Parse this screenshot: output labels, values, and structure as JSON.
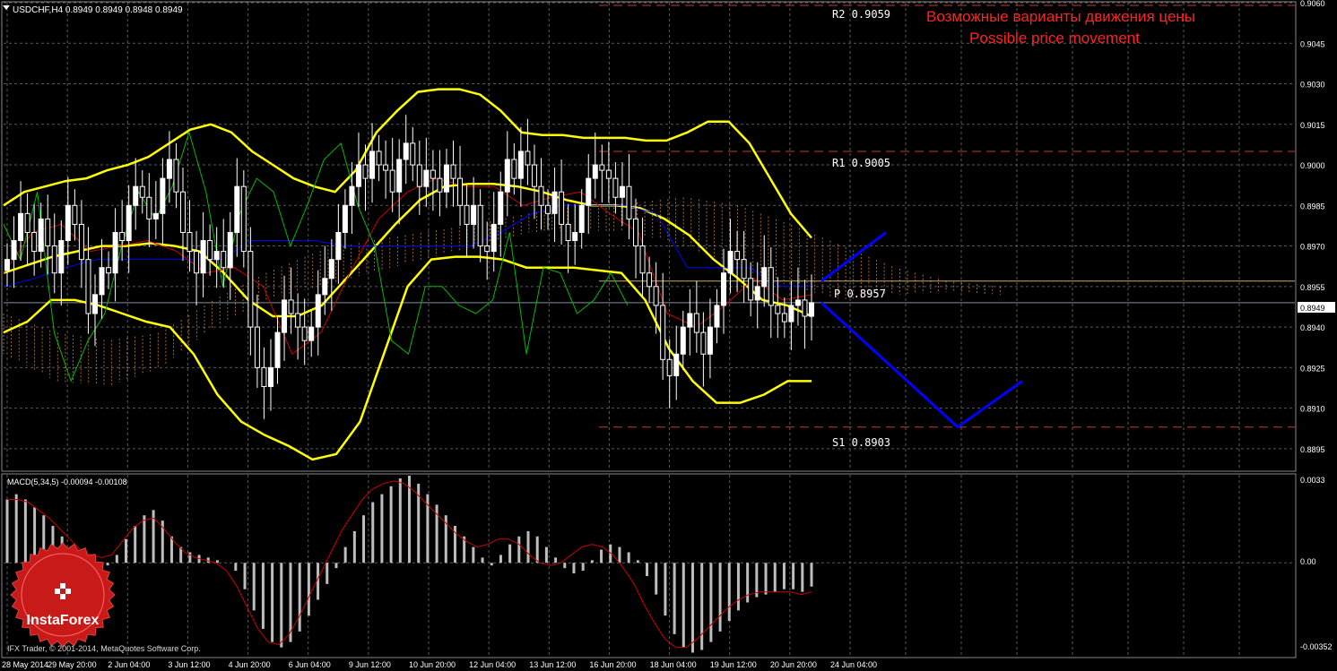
{
  "header": {
    "symbol_info": "USDCHF,H4  0.8949 0.8949 0.8948 0.8949"
  },
  "annotation": {
    "line1": "Возможные варианты движения цены",
    "line2": "Possible price movement"
  },
  "levels": [
    {
      "label": "R2  0.9059",
      "value": 0.9059
    },
    {
      "label": "R1  0.9005",
      "value": 0.9005
    },
    {
      "label": "P  0.8957",
      "value": 0.8957
    },
    {
      "label": "S1  0.8903",
      "value": 0.8903
    }
  ],
  "current_price": {
    "label": "0.8949",
    "value": 0.8949
  },
  "macd_panel": {
    "title": "MACD(5,34,5) -0.00094 -0.00108",
    "axis_labels": [
      "0.0033",
      "0.00",
      "-0.00352"
    ]
  },
  "watermark": {
    "copyright": "IFX Trader, © 2001-2014, MetaQuotes Software Corp.",
    "brand": "InstaForex"
  },
  "colors": {
    "background": "#000000",
    "grid": "#5a5a5a",
    "candles": "#ffffff",
    "bollinger": "#ffff00",
    "kijun": "#0000ff",
    "tenkan": "#cc0000",
    "chikou": "#00bb00",
    "cloud": "#cc8844",
    "forecast": "#0000ff",
    "level_line": "#b84030",
    "pivot_line": "#ccaa66",
    "annotation": "#ff2222"
  },
  "chart_data": [
    {
      "type": "candlestick",
      "title": "USDCHF,H4",
      "ylim": [
        0.8887,
        0.906
      ],
      "y_ticks": [
        "0.9060",
        "0.9045",
        "0.9030",
        "0.9015",
        "0.9000",
        "0.8985",
        "0.8970",
        "0.8955",
        "0.8940",
        "0.8925",
        "0.8910",
        "0.8895"
      ],
      "x_ticks": [
        "28 May 2014",
        "29 May 20:00",
        "2 Jun 04:00",
        "3 Jun 12:00",
        "4 Jun 20:00",
        "6 Jun 04:00",
        "9 Jun 12:00",
        "10 Jun 20:00",
        "12 Jun 04:00",
        "13 Jun 12:00",
        "16 Jun 20:00",
        "18 Jun 04:00",
        "19 Jun 12:00",
        "20 Jun 20:00",
        "24 Jun 04:00"
      ],
      "close": [
        0.8965,
        0.8972,
        0.8982,
        0.8975,
        0.8968,
        0.898,
        0.897,
        0.896,
        0.8972,
        0.8985,
        0.8978,
        0.8965,
        0.8945,
        0.8952,
        0.8962,
        0.896,
        0.8975,
        0.8972,
        0.8985,
        0.8992,
        0.8988,
        0.898,
        0.8982,
        0.8995,
        0.9002,
        0.899,
        0.8975,
        0.8968,
        0.896,
        0.8972,
        0.8965,
        0.8968,
        0.8962,
        0.8975,
        0.8992,
        0.8968,
        0.894,
        0.8925,
        0.8918,
        0.8925,
        0.8938,
        0.895,
        0.8945,
        0.894,
        0.8935,
        0.894,
        0.8952,
        0.8958,
        0.8965,
        0.8975,
        0.8985,
        0.8992,
        0.9,
        0.8995,
        0.9005,
        0.9,
        0.8998,
        0.899,
        0.9002,
        0.9008,
        0.9,
        0.8992,
        0.8998,
        0.8995,
        0.899,
        0.9,
        0.8995,
        0.8985,
        0.8978,
        0.8985,
        0.897,
        0.8968,
        0.8978,
        0.899,
        0.9002,
        0.8995,
        0.9005,
        0.9,
        0.8992,
        0.8985,
        0.8982,
        0.899,
        0.8978,
        0.8972,
        0.8975,
        0.8985,
        0.8995,
        0.9,
        0.8998,
        0.8995,
        0.8988,
        0.8992,
        0.898,
        0.897,
        0.896,
        0.8955,
        0.8948,
        0.8928,
        0.8922,
        0.893,
        0.894,
        0.8945,
        0.8938,
        0.893,
        0.894,
        0.8948,
        0.896,
        0.8968,
        0.8965,
        0.8958,
        0.895,
        0.8955,
        0.8962,
        0.8948,
        0.8945,
        0.8942,
        0.8948,
        0.895,
        0.8944,
        0.8949
      ],
      "series": [
        {
          "name": "Bollinger upper",
          "values": [
            0.8985,
            0.899,
            0.8992,
            0.8994,
            0.8995,
            0.8998,
            0.9,
            0.9003,
            0.9008,
            0.9013,
            0.9015,
            0.9012,
            0.9005,
            0.9,
            0.8995,
            0.8992,
            0.899,
            0.8998,
            0.9012,
            0.902,
            0.9027,
            0.9028,
            0.9028,
            0.9026,
            0.902,
            0.9012,
            0.9011,
            0.9011,
            0.901,
            0.901,
            0.901,
            0.9009,
            0.9009,
            0.9012,
            0.9016,
            0.9016,
            0.9008,
            0.8995,
            0.8982,
            0.8973
          ]
        },
        {
          "name": "Bollinger middle",
          "values": [
            0.896,
            0.8963,
            0.8966,
            0.8968,
            0.897,
            0.897,
            0.8971,
            0.897,
            0.8968,
            0.896,
            0.895,
            0.8944,
            0.8944,
            0.8948,
            0.8958,
            0.8968,
            0.8978,
            0.8987,
            0.8992,
            0.8993,
            0.8993,
            0.8992,
            0.899,
            0.8987,
            0.8985,
            0.8985,
            0.8984,
            0.898,
            0.8974,
            0.8965,
            0.8958,
            0.895,
            0.8948,
            0.8944
          ]
        },
        {
          "name": "Bollinger lower",
          "values": [
            0.8938,
            0.8942,
            0.895,
            0.895,
            0.8948,
            0.8945,
            0.8942,
            0.894,
            0.893,
            0.8915,
            0.8905,
            0.89,
            0.8896,
            0.8891,
            0.8893,
            0.8905,
            0.893,
            0.8955,
            0.8965,
            0.8966,
            0.8966,
            0.8965,
            0.8962,
            0.8962,
            0.8962,
            0.8961,
            0.896,
            0.895,
            0.8932,
            0.892,
            0.8912,
            0.8912,
            0.8915,
            0.892,
            0.892
          ]
        },
        {
          "name": "Kijun-sen",
          "values": [
            0.8955,
            0.8958,
            0.8962,
            0.8965,
            0.8965,
            0.8965,
            0.8965,
            0.8965,
            0.8972,
            0.8972,
            0.8972,
            0.897,
            0.897,
            0.897,
            0.897,
            0.897,
            0.8975,
            0.8982,
            0.8985,
            0.8985,
            0.8985,
            0.8982,
            0.8962,
            0.8962,
            0.8962,
            0.8955,
            0.8955
          ]
        },
        {
          "name": "Tenkan-sen",
          "values": [
            0.896,
            0.8975,
            0.8978,
            0.8968,
            0.897,
            0.8972,
            0.8968,
            0.896,
            0.8962,
            0.8955,
            0.893,
            0.8938,
            0.896,
            0.898,
            0.899,
            0.8995,
            0.8992,
            0.8992,
            0.8985,
            0.8988,
            0.899,
            0.8982,
            0.8975,
            0.8945,
            0.894,
            0.8948,
            0.8958,
            0.895,
            0.8952
          ]
        },
        {
          "name": "Chikou Span",
          "values": [
            0.8978,
            0.8965,
            0.899,
            0.8938,
            0.892,
            0.8935,
            0.8945,
            0.897,
            0.899,
            0.898,
            0.8992,
            0.9012,
            0.899,
            0.8955,
            0.8982,
            0.8995,
            0.899,
            0.897,
            0.8985,
            0.9002,
            0.9008,
            0.8985,
            0.897,
            0.8935,
            0.893,
            0.8955,
            0.8955,
            0.8948,
            0.8945,
            0.895,
            0.8975,
            0.893,
            0.8962,
            0.896,
            0.8945,
            0.895,
            0.896,
            0.8948
          ]
        },
        {
          "name": "Forecast upper",
          "values": [
            0.8957,
            0.8975
          ]
        },
        {
          "name": "Forecast lower",
          "values": [
            0.8949,
            0.8903,
            0.892
          ]
        }
      ]
    },
    {
      "type": "bar",
      "title": "MACD(5,34,5) -0.00094 -0.00108",
      "ylim": [
        -0.00352,
        0.0033
      ],
      "values": [
        0.0024,
        0.0026,
        0.0024,
        0.0021,
        0.0018,
        0.0014,
        0.001,
        0.0006,
        0.0002,
        -0.0002,
        -0.0003,
        -0.0001,
        0.0003,
        0.0009,
        0.0014,
        0.0018,
        0.002,
        0.0016,
        0.001,
        0.0006,
        0.0004,
        0.0003,
        0.0002,
        0.0001,
        0.0,
        -0.0003,
        -0.001,
        -0.0018,
        -0.0025,
        -0.003,
        -0.0032,
        -0.003,
        -0.0026,
        -0.002,
        -0.0014,
        -0.0008,
        -0.0002,
        0.0006,
        0.0012,
        0.0018,
        0.0023,
        0.0026,
        0.0029,
        0.0032,
        0.0033,
        0.003,
        0.0026,
        0.0022,
        0.0018,
        0.0014,
        0.001,
        0.0006,
        0.0002,
        -0.0001,
        0.0003,
        0.0007,
        0.001,
        0.0012,
        0.001,
        0.0006,
        0.0002,
        -0.0002,
        -0.0004,
        -0.0003,
        0.0001,
        0.0005,
        0.0007,
        0.0006,
        0.0004,
        0.0001,
        -0.0005,
        -0.0012,
        -0.002,
        -0.0027,
        -0.0032,
        -0.0034,
        -0.0033,
        -0.003,
        -0.0026,
        -0.0022,
        -0.0018,
        -0.0015,
        -0.0013,
        -0.0012,
        -0.0011,
        -0.001,
        -0.001,
        -0.0011,
        -0.0009
      ],
      "series": [
        {
          "name": "Signal",
          "values": [
            0.0024,
            0.0024,
            0.0023,
            0.002,
            0.0017,
            0.0013,
            0.0009,
            0.0005,
            0.0003,
            0.0002,
            0.0003,
            0.0008,
            0.0013,
            0.0016,
            0.0017,
            0.0013,
            0.0008,
            0.0004,
            0.0002,
            0.0001,
            0.0,
            -0.0003,
            -0.0009,
            -0.0017,
            -0.0025,
            -0.003,
            -0.0031,
            -0.0027,
            -0.002,
            -0.0012,
            -0.0004,
            0.0004,
            0.0012,
            0.0018,
            0.0024,
            0.0028,
            0.003,
            0.0031,
            0.003,
            0.0027,
            0.0023,
            0.0019,
            0.0015,
            0.0011,
            0.0008,
            0.0006,
            0.0007,
            0.0009,
            0.0009,
            0.0007,
            0.0003,
            0.0,
            -0.0001,
            0.0,
            0.0003,
            0.0006,
            0.0007,
            0.0006,
            0.0003,
            -0.0002,
            -0.0008,
            -0.0016,
            -0.0023,
            -0.0029,
            -0.0032,
            -0.0032,
            -0.0029,
            -0.0025,
            -0.0021,
            -0.0017,
            -0.0014,
            -0.0012,
            -0.0011,
            -0.0011,
            -0.0011,
            -0.0011,
            -0.0012,
            -0.0011
          ]
        }
      ]
    }
  ]
}
